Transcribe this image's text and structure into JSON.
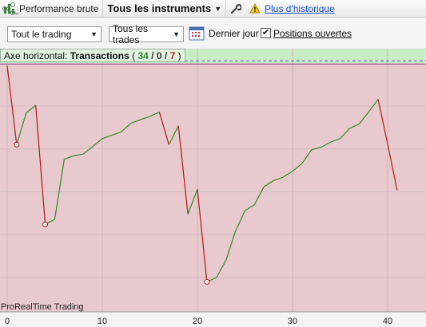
{
  "toolbar": {
    "performance_label": "Performance brute",
    "instruments_label": "Tous les instruments",
    "history_link": "Plus d'historique",
    "icons": [
      "bar-chart-icon",
      "wrench-icon",
      "warning-icon",
      "share-icon"
    ]
  },
  "options": {
    "trading_select": "Tout le trading",
    "trades_select": "Tous les trades",
    "last_day_label": "Dernier jour",
    "open_positions_label": "Positions ouvertes",
    "open_positions_checked": true
  },
  "axis_info": {
    "prefix": "Axe horizontal:",
    "mode": "Transactions",
    "open": "(",
    "wins": "34",
    "sep1": "/",
    "neutral": "0",
    "sep2": "/",
    "losses": "7",
    "close": ")"
  },
  "watermark": "ProRealTime Trading",
  "colors": {
    "profit_zone": "#c9ecc7",
    "loss_zone": "#e8c9cd",
    "up_line": "#2e8b22",
    "down_line": "#b01818",
    "link": "#1a4fd8"
  },
  "chart_data": {
    "type": "line",
    "x": [
      0,
      1,
      2,
      3,
      4,
      5,
      6,
      7,
      8,
      9,
      10,
      11,
      12,
      13,
      14,
      15,
      16,
      17,
      18,
      19,
      20,
      21,
      22,
      23,
      24,
      25,
      26,
      27,
      28,
      29,
      30,
      31,
      32,
      33,
      34,
      35,
      36,
      37,
      38,
      39,
      40,
      41
    ],
    "y": [
      -0.3,
      -9.5,
      -5.8,
      -4.9,
      -18.8,
      -18.2,
      -11.2,
      -10.8,
      -10.6,
      -9.7,
      -8.8,
      -8.4,
      -8.0,
      -7.0,
      -6.6,
      -6.2,
      -5.7,
      -9.5,
      -7.3,
      -17.6,
      -14.7,
      -25.5,
      -25.0,
      -23.0,
      -19.6,
      -17.2,
      -16.5,
      -14.4,
      -13.7,
      -13.3,
      -12.6,
      -11.7,
      -10.1,
      -9.8,
      -9.2,
      -8.8,
      -7.6,
      -7.1,
      -5.7,
      -4.2,
      -9.4,
      -14.8
    ],
    "xlim": [
      0,
      43.7
    ],
    "ylim": [
      -29,
      1.7
    ],
    "x_ticks": [
      0,
      10,
      20,
      30,
      40
    ],
    "x_tick_labels": [
      "0",
      "10",
      "20",
      "30",
      "40"
    ],
    "marked_points_x": [
      1,
      4,
      21
    ],
    "grid": true
  }
}
